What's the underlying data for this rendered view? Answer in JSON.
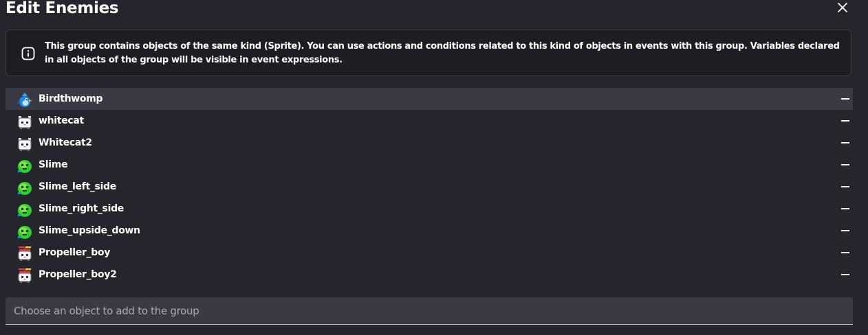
{
  "dialog": {
    "title": "Edit Enemies",
    "close_icon": "close-icon"
  },
  "info": {
    "icon": "info-icon",
    "text": "This group contains objects of the same kind (Sprite). You can use actions and conditions related to this kind of objects in events with this group. Variables declared in all objects of the group will be visible in event expressions."
  },
  "objects": [
    {
      "name": "Birdthwomp",
      "icon": "bird-sprite-icon",
      "selected": true
    },
    {
      "name": "whitecat",
      "icon": "white-cat-sprite-icon"
    },
    {
      "name": "Whitecat2",
      "icon": "white-cat-sprite-icon"
    },
    {
      "name": "Slime",
      "icon": "slime-sprite-icon"
    },
    {
      "name": "Slime_left_side",
      "icon": "slime-sprite-icon"
    },
    {
      "name": "Slime_right_side",
      "icon": "slime-sprite-icon"
    },
    {
      "name": "Slime_upside_down",
      "icon": "slime-sprite-icon"
    },
    {
      "name": "Propeller_boy",
      "icon": "propeller-boy-sprite-icon"
    },
    {
      "name": "Propeller_boy2",
      "icon": "propeller-boy-sprite-icon"
    }
  ],
  "remove_icon": "remove-icon",
  "add_object": {
    "placeholder": "Choose an object to add to the group",
    "value": ""
  },
  "colors": {
    "background": "#25252e",
    "info_box": "#1d1d24",
    "selected_row": "#3a3a45",
    "input_background": "#3a3a45",
    "text": "#ffffff",
    "placeholder": "#a9a9b3"
  }
}
